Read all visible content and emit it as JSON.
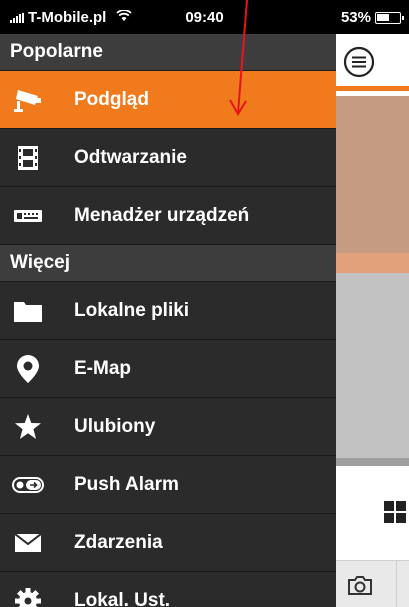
{
  "status_bar": {
    "carrier": "T-Mobile.pl",
    "time": "09:40",
    "battery": "53%"
  },
  "drawer": {
    "sections": [
      {
        "title": "Popolarne",
        "items": [
          {
            "label": "Podgląd",
            "icon": "cctv-camera-icon",
            "active": true
          },
          {
            "label": "Odtwarzanie",
            "icon": "film-icon"
          },
          {
            "label": "Menadżer urządzeń",
            "icon": "dvr-device-icon"
          }
        ]
      },
      {
        "title": "Więcej",
        "items": [
          {
            "label": "Lokalne pliki",
            "icon": "folder-icon"
          },
          {
            "label": "E-Map",
            "icon": "map-pin-icon"
          },
          {
            "label": "Ulubiony",
            "icon": "star-icon"
          },
          {
            "label": "Push Alarm",
            "icon": "push-alarm-toggle-icon"
          },
          {
            "label": "Zdarzenia",
            "icon": "envelope-icon"
          },
          {
            "label": "Lokal. Ust.",
            "icon": "gear-icon"
          }
        ]
      }
    ]
  },
  "colors": {
    "accent": "#f07a1c",
    "drawer_bg": "#2b2b2b",
    "section_bg": "#3d3d3d",
    "annotation_arrow": "#e8141c"
  }
}
